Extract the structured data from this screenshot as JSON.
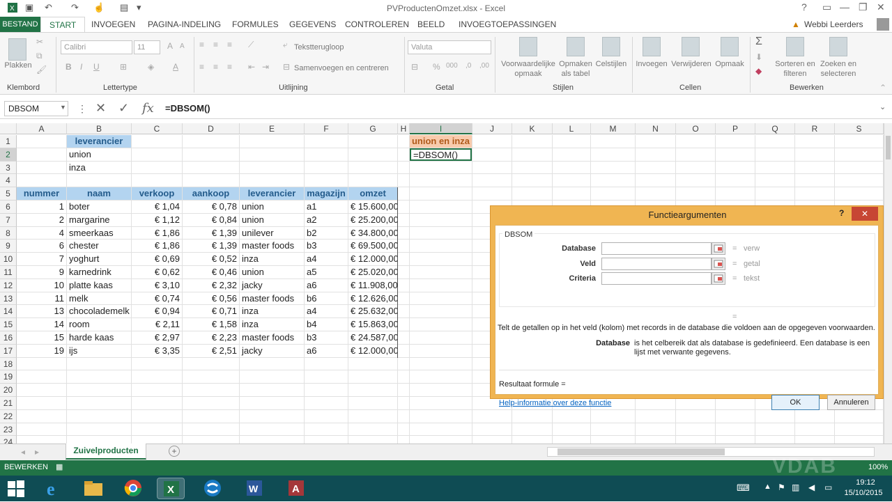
{
  "window": {
    "title": "PVProductenOmzet.xlsx - Excel"
  },
  "ribbon": {
    "tabs": [
      "BESTAND",
      "START",
      "INVOEGEN",
      "PAGINA-INDELING",
      "FORMULES",
      "GEGEVENS",
      "CONTROLEREN",
      "BEELD",
      "INVOEGTOEPASSINGEN"
    ],
    "user": "Webbi Leerders",
    "groups": [
      "Klembord",
      "Lettertype",
      "Uitlijning",
      "Getal",
      "Stijlen",
      "Cellen",
      "Bewerken"
    ],
    "paste": "Plakken",
    "font": "Calibri",
    "font_size": "11",
    "wrap": "Tekstterugloop",
    "merge": "Samenvoegen en centreren",
    "number_format": "Valuta",
    "cond_format": "Voorwaardelijke opmaak",
    "format_table": "Opmaken als tabel",
    "cell_styles": "Celstijlen",
    "insert": "Invoegen",
    "delete": "Verwijderen",
    "format": "Opmaak",
    "sort": "Sorteren en filteren",
    "find": "Zoeken en selecteren",
    "bold": "B",
    "italic": "I",
    "underline": "U"
  },
  "formula_bar": {
    "name_box": "DBSOM",
    "formula": "=DBSOM()"
  },
  "columns": [
    "A",
    "B",
    "C",
    "D",
    "E",
    "F",
    "G",
    "H",
    "I",
    "J",
    "K",
    "L",
    "M",
    "N",
    "O",
    "P",
    "Q",
    "R",
    "S"
  ],
  "rows": [
    "1",
    "2",
    "3",
    "4",
    "5",
    "6",
    "7",
    "8",
    "9",
    "10",
    "11",
    "12",
    "13",
    "14",
    "15",
    "16",
    "17",
    "18",
    "19",
    "20",
    "21",
    "22",
    "23",
    "24"
  ],
  "criteria": {
    "header": "leverancier",
    "values": [
      "union",
      "inza"
    ]
  },
  "table": {
    "headers": [
      "nummer",
      "naam",
      "verkoop",
      "aankoop",
      "leverancier",
      "magazijn",
      "omzet"
    ],
    "rows": [
      [
        "1",
        "boter",
        "€ 1,04",
        "€ 0,78",
        "union",
        "a1",
        "€ 15.600,00"
      ],
      [
        "2",
        "margarine",
        "€ 1,12",
        "€ 0,84",
        "union",
        "a2",
        "€ 25.200,00"
      ],
      [
        "4",
        "smeerkaas",
        "€ 1,86",
        "€ 1,39",
        "unilever",
        "b2",
        "€ 34.800,00"
      ],
      [
        "6",
        "chester",
        "€ 1,86",
        "€ 1,39",
        "master foods",
        "b3",
        "€ 69.500,00"
      ],
      [
        "7",
        "yoghurt",
        "€ 0,69",
        "€ 0,52",
        "inza",
        "a4",
        "€ 12.000,00"
      ],
      [
        "9",
        "karnedrink",
        "€ 0,62",
        "€ 0,46",
        "union",
        "a5",
        "€ 25.020,00"
      ],
      [
        "10",
        "platte kaas",
        "€ 3,10",
        "€ 2,32",
        "jacky",
        "a6",
        "€ 11.908,00"
      ],
      [
        "11",
        "melk",
        "€ 0,74",
        "€ 0,56",
        "master foods",
        "b6",
        "€ 12.626,00"
      ],
      [
        "13",
        "chocolademelk",
        "€ 0,94",
        "€ 0,71",
        "inza",
        "a4",
        "€ 25.632,00"
      ],
      [
        "14",
        "room",
        "€ 2,11",
        "€ 1,58",
        "inza",
        "b4",
        "€ 15.863,00"
      ],
      [
        "15",
        "harde kaas",
        "€ 2,97",
        "€ 2,23",
        "master foods",
        "b3",
        "€ 24.587,00"
      ],
      [
        "19",
        "ijs",
        "€ 3,35",
        "€ 2,51",
        "jacky",
        "a6",
        "€ 12.000,00"
      ]
    ]
  },
  "i_column": {
    "header": "union en inza",
    "formula": "=DBSOM()"
  },
  "dialog": {
    "title": "Functieargumenten",
    "help_char": "?",
    "function": "DBSOM",
    "args": [
      {
        "label": "Database",
        "hint": "verw"
      },
      {
        "label": "Veld",
        "hint": "getal"
      },
      {
        "label": "Criteria",
        "hint": "tekst"
      }
    ],
    "eq": "=",
    "description": "Telt de getallen op in het veld (kolom) met records in de database die voldoen aan de opgegeven voorwaarden.",
    "arg_name": "Database",
    "arg_desc": "is het celbereik dat als database is gedefinieerd. Een database is een lijst met verwante gegevens.",
    "result": "Resultaat formule =",
    "help_link": "Help-informatie over deze functie",
    "ok": "OK",
    "cancel": "Annuleren"
  },
  "sheet_tab": "Zuivelproducten",
  "status": {
    "mode": "BEWERKEN",
    "zoom": "100%"
  },
  "watermark": "VDAB",
  "clock": {
    "time": "19:12",
    "date": "15/10/2015"
  }
}
